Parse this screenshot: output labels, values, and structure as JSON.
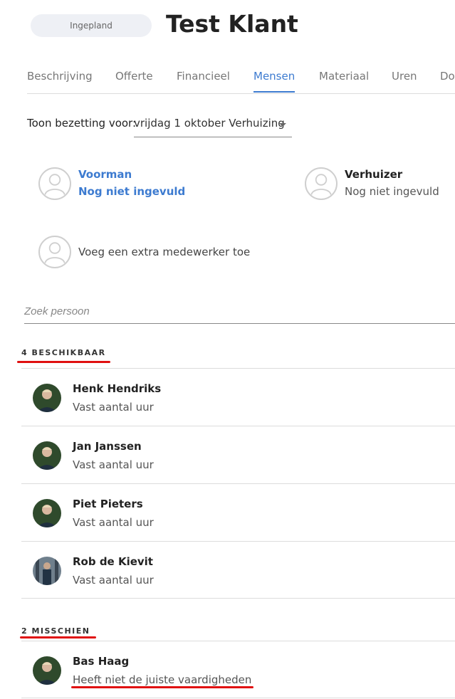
{
  "header": {
    "status": "Ingepland",
    "title": "Test Klant"
  },
  "tabs": [
    {
      "label": "Beschrijving"
    },
    {
      "label": "Offerte"
    },
    {
      "label": "Financieel"
    },
    {
      "label": "Mensen"
    },
    {
      "label": "Materiaal"
    },
    {
      "label": "Uren"
    },
    {
      "label": "Do"
    }
  ],
  "active_tab": "Mensen",
  "occupancy": {
    "label": "Toon bezetting voor:",
    "value": "vrijdag 1 oktober Verhuizing"
  },
  "roles": [
    {
      "title": "Voorman",
      "status": "Nog niet ingevuld"
    },
    {
      "title": "Verhuizer",
      "status": "Nog niet ingevuld"
    }
  ],
  "add_employee": "Voeg een extra medewerker toe",
  "search": {
    "placeholder": "Zoek persoon"
  },
  "sections": [
    {
      "header": "4 BESCHIKBAAR",
      "people": [
        {
          "name": "Henk Hendriks",
          "sub": "Vast aantal uur"
        },
        {
          "name": "Jan Janssen",
          "sub": "Vast aantal uur"
        },
        {
          "name": "Piet Pieters",
          "sub": "Vast aantal uur"
        },
        {
          "name": "Rob de Kievit",
          "sub": "Vast aantal uur"
        }
      ]
    },
    {
      "header": "2 MISSCHIEN",
      "people": [
        {
          "name": "Bas Haag",
          "sub": "Heeft niet de juiste vaardigheden"
        }
      ]
    }
  ],
  "colors": {
    "accent": "#3d7bd0",
    "annotation": "#e01010"
  },
  "icons": {
    "role_placeholder": "user-placeholder-icon",
    "dropdown": "caret-down-icon"
  }
}
